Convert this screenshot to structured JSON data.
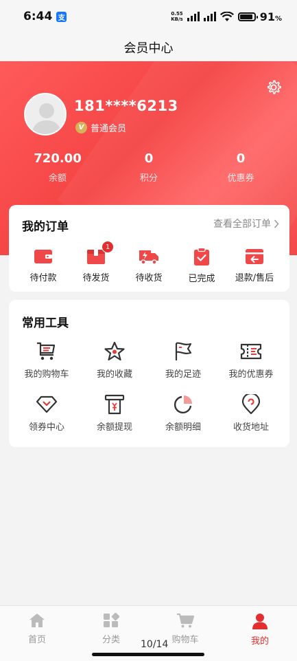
{
  "status": {
    "time": "6:44",
    "net_speed": "0.55",
    "net_unit": "KB/s",
    "battery": "91",
    "battery_unit": "%",
    "alipay_glyph": "支"
  },
  "header": {
    "title": "会员中心"
  },
  "profile": {
    "phone": "181****6213",
    "member_level": "普通会员",
    "badge_glyph": "V",
    "stats": [
      {
        "value": "720.00",
        "label": "余额"
      },
      {
        "value": "0",
        "label": "积分"
      },
      {
        "value": "0",
        "label": "优惠券"
      }
    ]
  },
  "orders": {
    "title": "我的订单",
    "view_all": "查看全部订单",
    "items": [
      {
        "label": "待付款",
        "icon": "wallet-icon",
        "badge": ""
      },
      {
        "label": "待发货",
        "icon": "box-icon",
        "badge": "1"
      },
      {
        "label": "待收货",
        "icon": "truck-icon",
        "badge": ""
      },
      {
        "label": "已完成",
        "icon": "clipboard-check-icon",
        "badge": ""
      },
      {
        "label": "退款/售后",
        "icon": "refund-icon",
        "badge": ""
      }
    ]
  },
  "tools": {
    "title": "常用工具",
    "items": [
      {
        "label": "我的购物车",
        "icon": "cart-icon"
      },
      {
        "label": "我的收藏",
        "icon": "star-icon"
      },
      {
        "label": "我的足迹",
        "icon": "flag-icon"
      },
      {
        "label": "我的优惠券",
        "icon": "ticket-icon"
      },
      {
        "label": "领券中心",
        "icon": "diamond-icon"
      },
      {
        "label": "余额提现",
        "icon": "atm-icon"
      },
      {
        "label": "余额明细",
        "icon": "pie-chart-icon"
      },
      {
        "label": "收货地址",
        "icon": "location-pin-icon"
      }
    ]
  },
  "tabbar": {
    "items": [
      {
        "label": "首页",
        "icon": "home-icon"
      },
      {
        "label": "分类",
        "icon": "category-icon"
      },
      {
        "label": "购物车",
        "icon": "cart-icon"
      },
      {
        "label": "我的",
        "icon": "user-icon"
      }
    ],
    "pager": "10/14"
  },
  "colors": {
    "brand_red": "#f04848",
    "accent_red": "#e62d2d",
    "tab_inactive": "#999999",
    "gold_badge": "#d8b25a"
  }
}
